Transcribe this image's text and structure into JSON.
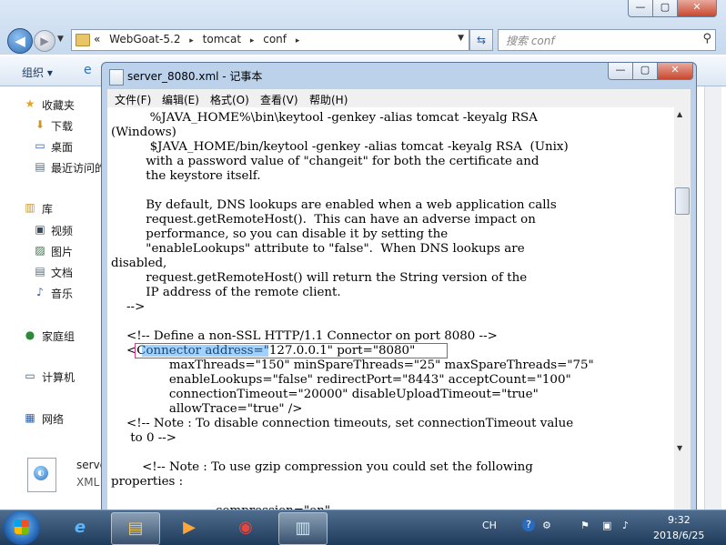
{
  "explorer": {
    "window_controls": {
      "minimize": "—",
      "maximize": "▢",
      "close": "✕"
    },
    "breadcrumb": {
      "prefix": "«",
      "items": [
        "WebGoat-5.2",
        "tomcat",
        "conf"
      ],
      "separator": "▸"
    },
    "search_placeholder": "搜索 conf",
    "toolbar": {
      "organize": "组织 ▾"
    },
    "sidebar": {
      "items": [
        {
          "label": "收藏夹",
          "icon": "★"
        },
        {
          "label": "下载",
          "icon": "⬇"
        },
        {
          "label": "桌面",
          "icon": "▭"
        },
        {
          "label": "最近访问的",
          "icon": "▤"
        },
        {
          "label": "库",
          "icon": "▥"
        },
        {
          "label": "视频",
          "icon": "▣"
        },
        {
          "label": "图片",
          "icon": "▨"
        },
        {
          "label": "文档",
          "icon": "▤"
        },
        {
          "label": "音乐",
          "icon": "♪"
        },
        {
          "label": "家庭组",
          "icon": "●"
        },
        {
          "label": "计算机",
          "icon": "▭"
        },
        {
          "label": "网络",
          "icon": "▦"
        }
      ]
    },
    "selected_file": {
      "name": "serve",
      "type": "XML"
    }
  },
  "notepad": {
    "title": "server_8080.xml - 记事本",
    "window_controls": {
      "minimize": "—",
      "maximize": "▢",
      "close": "✕"
    },
    "menu": [
      "文件(F)",
      "编辑(E)",
      "格式(O)",
      "查看(V)",
      "帮助(H)"
    ],
    "content": "          %JAVA_HOME%\\bin\\keytool -genkey -alias tomcat -keyalg RSA\n(Windows)\n          $JAVA_HOME/bin/keytool -genkey -alias tomcat -keyalg RSA  (Unix)\n         with a password value of \"changeit\" for both the certificate and\n         the keystore itself.\n\n         By default, DNS lookups are enabled when a web application calls\n         request.getRemoteHost().  This can have an adverse impact on\n         performance, so you can disable it by setting the\n         \"enableLookups\" attribute to \"false\".  When DNS lookups are\ndisabled,\n         request.getRemoteHost() will return the String version of the\n         IP address of the remote client.\n    -->\n\n    <!-- Define a non-SSL HTTP/1.1 Connector on port 8080 -->\n    <Connector address=\"127.0.0.1\" port=\"8080\"\n               maxThreads=\"150\" minSpareThreads=\"25\" maxSpareThreads=\"75\"\n               enableLookups=\"false\" redirectPort=\"8443\" acceptCount=\"100\"\n               connectionTimeout=\"20000\" disableUploadTimeout=\"true\"\n               allowTrace=\"true\" />\n    <!-- Note : To disable connection timeouts, set connectionTimeout value\n     to 0 -->\n\n\t<!-- Note : To use gzip compression you could set the following\nproperties :\n\n\t\t\t   compression=\"on\""
  },
  "taskbar": {
    "start_label": "⊞",
    "apps": [
      {
        "icon": "e"
      },
      {
        "icon": "▤"
      },
      {
        "icon": "▶"
      },
      {
        "icon": "◉"
      },
      {
        "icon": "▥"
      }
    ],
    "tray": {
      "lang": "CH",
      "help": "?",
      "time": "9:32",
      "date": "2018/6/25"
    }
  },
  "colors": {
    "highlight_box": "#e0338f",
    "selection": "#3399ff"
  }
}
